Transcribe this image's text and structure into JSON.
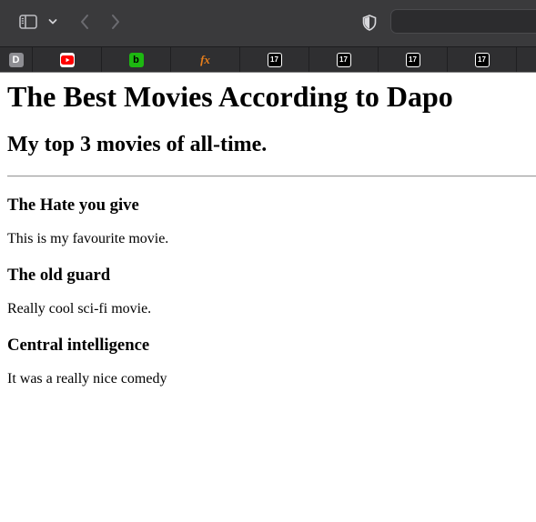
{
  "browser": {
    "favorites": [
      {
        "name": "d-favorite",
        "glyph": "D"
      },
      {
        "name": "youtube-favorite",
        "glyph": ""
      },
      {
        "name": "b-favorite",
        "glyph": "b"
      },
      {
        "name": "fx-favorite",
        "glyph": "fx"
      },
      {
        "name": "tradingview-favorite-1",
        "glyph": "17"
      },
      {
        "name": "tradingview-favorite-2",
        "glyph": "17"
      },
      {
        "name": "tradingview-favorite-3",
        "glyph": "17"
      },
      {
        "name": "tradingview-favorite-4",
        "glyph": "17"
      }
    ],
    "colors": {
      "toolbar": "#3a3a3c",
      "favbar": "#2f2f31",
      "youtube_red": "#ff0000",
      "b_green": "#1db811",
      "fx_orange": "#e87f1b"
    }
  },
  "page": {
    "title": "The Best Movies According to Dapo",
    "subtitle": "My top 3 movies of all-time.",
    "movies": [
      {
        "title": "The Hate you give",
        "description": "This is my favourite movie."
      },
      {
        "title": "The old guard",
        "description": "Really cool sci-fi movie."
      },
      {
        "title": "Central intelligence",
        "description": "It was a really nice comedy"
      }
    ]
  }
}
